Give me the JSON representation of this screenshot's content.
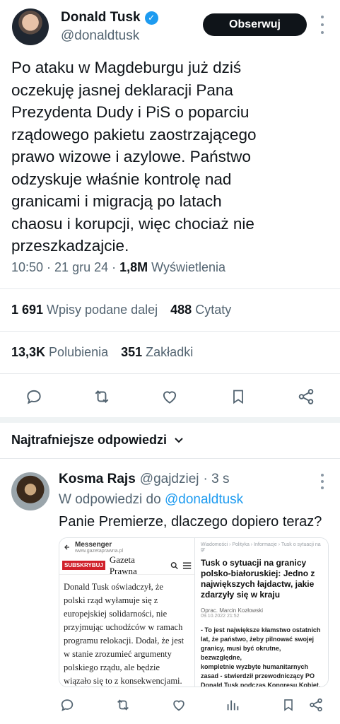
{
  "tweet": {
    "author_name": "Donald Tusk",
    "author_handle": "@donaldtusk",
    "follow_label": "Obserwuj",
    "text_lines": [
      "Po ataku w Magdeburgu już dziś",
      "oczekuję jasnej deklaracji Pana",
      "Prezydenta Dudy i PiS o poparciu",
      "rządowego pakietu zaostrzającego",
      "prawo wizowe i azylowe. Państwo",
      "odzyskuje właśnie kontrolę nad",
      "granicami i migracją po latach",
      "chaosu i korupcji, więc chociaż nie",
      "przeszkadzajcie."
    ],
    "time": "10:50 · 21 gru 24 ·",
    "views_count": "1,8M",
    "views_label": "Wyświetlenia"
  },
  "stats": {
    "reposts_count": "1 691",
    "reposts_label": "Wpisy podane dalej",
    "quotes_count": "488",
    "quotes_label": "Cytaty",
    "likes_count": "13,3K",
    "likes_label": "Polubienia",
    "bookmarks_count": "351",
    "bookmarks_label": "Zakładki"
  },
  "replies_section": {
    "title": "Najtrafniejsze odpowiedzi"
  },
  "reply": {
    "name": "Kosma Rajs",
    "handle": "@gajdziej",
    "age": "· 3 s",
    "reply_to_prefix": "W odpowiedzi do",
    "reply_to_handle": "@donaldtusk",
    "text": "Panie Premierze, dlaczego dopiero teraz?",
    "media": {
      "left": {
        "app_title": "Messenger",
        "url": "www.gazetaprawna.pl",
        "subscribe_label": "SUBSKRYBUJ",
        "logo": "Gazeta Prawna",
        "body_lines": [
          "Donald Tusk oświadczył, że",
          "polski rząd wyłamuje się z",
          "europejskiej solidarności, nie",
          "przyjmując uchodźców w ramach",
          "programu relokacji. Dodał, że jest",
          "w stanie zrozumieć argumenty",
          "polskiego rządu, ale będzie",
          "wiązało się to z konsekwencjami."
        ]
      },
      "right": {
        "crumbs": "Wiadomości › Polityka › Informacje › Tusk o sytuacji na gr",
        "title_lines": [
          "Tusk o sytuacji na granicy",
          "polsko-białoruskiej: Jedno z",
          "największych łajdactw, jakie",
          "zdarzyły się w kraju"
        ],
        "author": "Oprac. Marcin Kozłowski",
        "date": "09.10.2022 21:52",
        "body_lines": [
          "- To jest największe kłamstwo ostatnich",
          "lat, że państwo, żeby pilnować swojej",
          "granicy, musi być okrutne, bezwzględne,",
          "kompletnie wyzbyte humanitarnych",
          "zasad - stwierdził przewodniczący PO",
          "Donald Tusk podczas Kongresu Kobiet,"
        ]
      }
    }
  },
  "colors": {
    "text": "#0f1419",
    "secondary": "#536471",
    "accent": "#1d9bf0",
    "icon": "#536471"
  }
}
